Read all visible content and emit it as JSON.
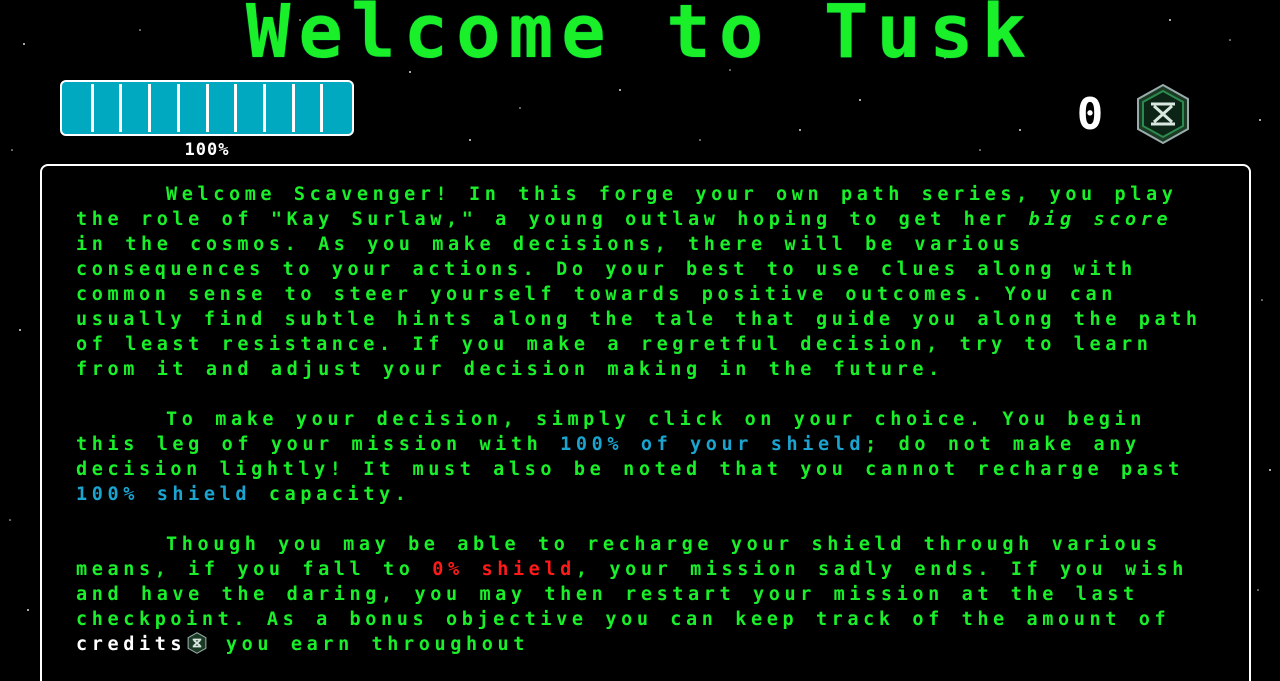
{
  "title": "Welcome to Tusk",
  "hud": {
    "shield_percent_label": "100%",
    "shield_level": 1.0,
    "shield_segments": 10,
    "credits_count": "0",
    "credits_icon": "credits-emblem-icon"
  },
  "colors": {
    "accent_green": "#19f02a",
    "shield_cyan": "#00a8c0",
    "highlight_cyan": "#1aa4d0",
    "danger_red": "#ff1a1a",
    "background": "#000000"
  },
  "intro": {
    "p1": {
      "a": "Welcome Scavenger! In this forge your own path series, you play the role of \"Kay Surlaw,\" a young outlaw hoping to get her ",
      "em": "big score",
      "b": " in the cosmos. As you make decisions, there will be various consequences to your actions. Do your best to use clues along with common sense to steer yourself towards positive outcomes. You can usually find subtle hints along the tale that guide you along the path of least resistance. If you make a regretful decision, try to learn from it and adjust your decision making in the future."
    },
    "p2": {
      "a": "To make your decision, simply click on your choice. You begin this leg of your mission with ",
      "hl1": "100% of your shield",
      "b": "; do not make any decision lightly! It must also be noted that you cannot recharge past ",
      "hl2": "100% shield",
      "c": " capacity."
    },
    "p3": {
      "a": "Though you may be able to recharge your shield through various means, if you fall to ",
      "hl_red": "0% shield",
      "b": ", your mission sadly ends. If you wish and have the daring, you may then restart your mission at the last checkpoint. As a bonus objective you can keep track of the amount of ",
      "credits_word": "credits",
      "c": " you earn throughout"
    }
  }
}
